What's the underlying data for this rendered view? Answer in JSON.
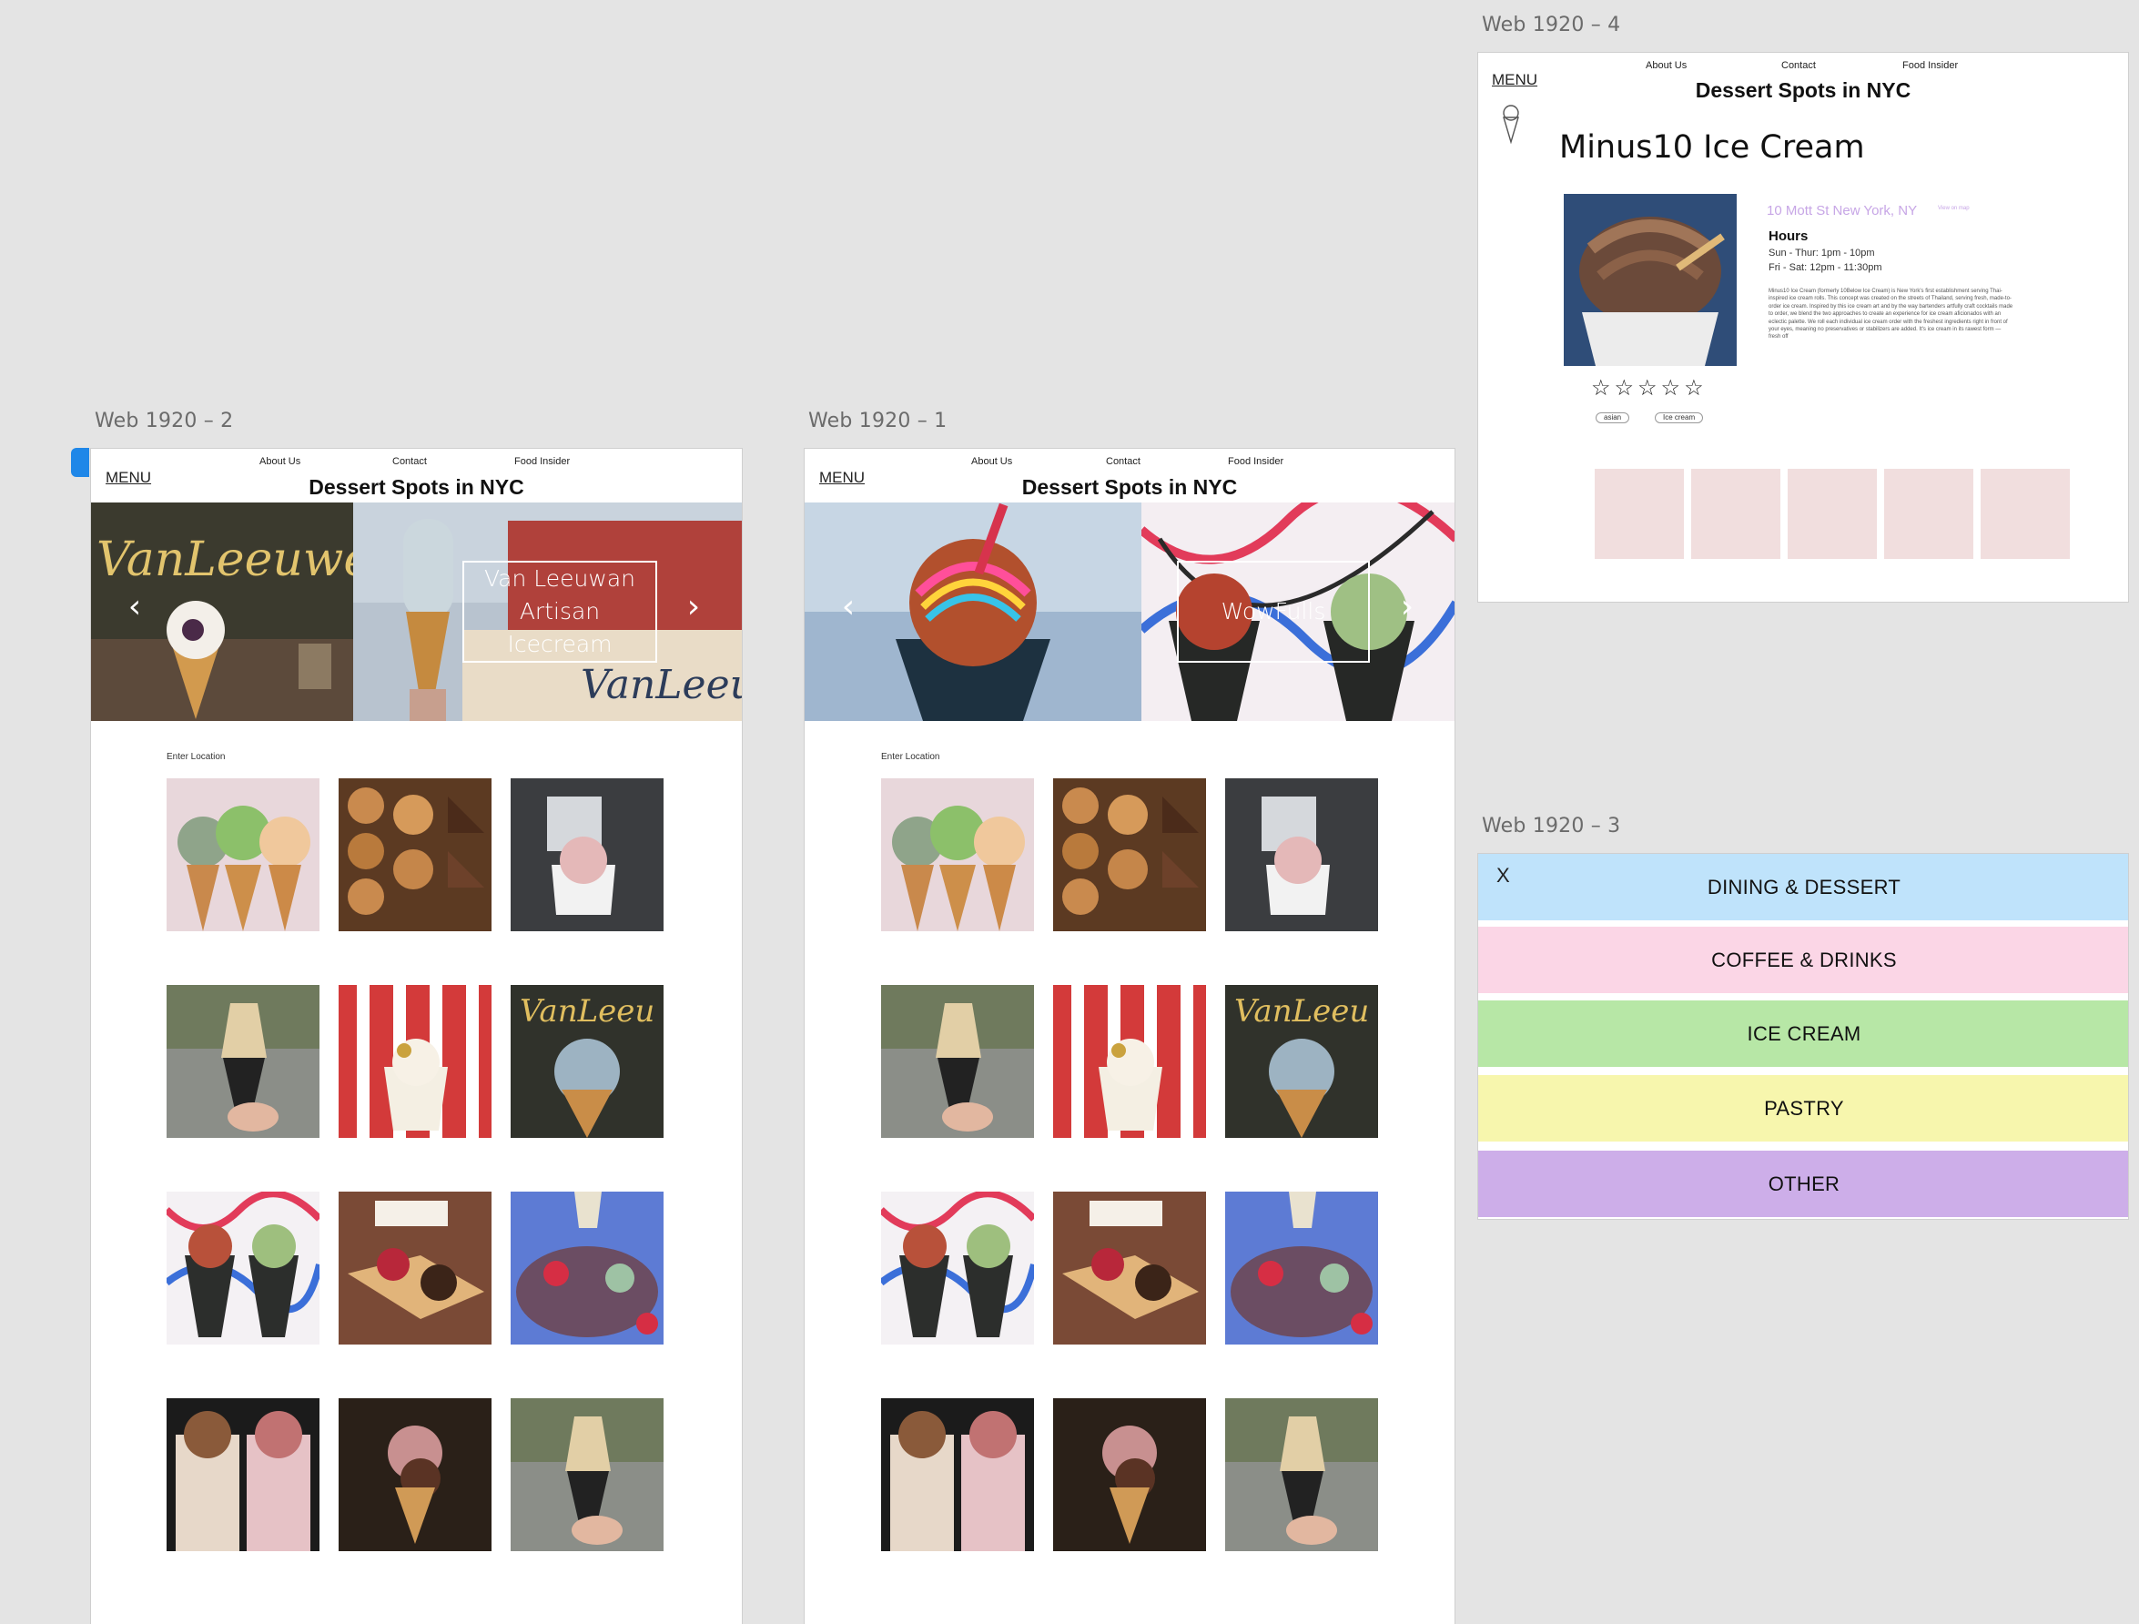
{
  "artboards": {
    "web2": {
      "label": "Web 1920 – 2",
      "hero_caption": "Van Leeuwan Artisan Icecream"
    },
    "web1": {
      "label": "Web 1920 – 1",
      "hero_caption": "WowFulls"
    },
    "web4": {
      "label": "Web 1920 – 4"
    },
    "web3": {
      "label": "Web 1920 – 3"
    }
  },
  "site": {
    "title": "Dessert Spots in NYC",
    "menu_label": "MENU",
    "nav": [
      "About Us",
      "Contact",
      "Food Insider"
    ],
    "enter_location": "Enter Location",
    "arrow_prev": "‹",
    "arrow_next": "›"
  },
  "detail": {
    "name": "Minus10 Ice Cream",
    "address": "10 Mott St New York, NY",
    "map_link": "View on map",
    "hours_heading": "Hours",
    "hours": [
      "Sun - Thur: 1pm - 10pm",
      "Fri - Sat: 12pm - 11:30pm"
    ],
    "description": "Minus10 Ice Cream (formerly 10Below Ice Cream) is New York's first establishment serving Thai-inspired ice cream rolls. This concept was created on the streets of Thailand, serving fresh, made-to-order ice cream. Inspired by this ice cream art and by the way bartenders artfully craft cocktails made to order, we blend the two approaches to create an experience for ice cream aficionados with an eclectic palette. We roll each individual ice cream order with the freshest ingredients right in front of your eyes, meaning no preservatives or stabilizers are added. It's ice cream in its rawest form — fresh off",
    "rating_stars": "☆☆☆☆☆",
    "tags": [
      "asian",
      "Ice cream"
    ]
  },
  "menu": {
    "close": "X",
    "items": [
      {
        "label": "DINING & DESSERT",
        "color": "#bfe3fb"
      },
      {
        "label": "COFFEE & DRINKS",
        "color": "#fbd6e6"
      },
      {
        "label": "ICE CREAM",
        "color": "#b7e7a6"
      },
      {
        "label": "PASTRY",
        "color": "#f7f6ad"
      },
      {
        "label": "OTHER",
        "color": "#cdaee9"
      }
    ]
  },
  "accent": {
    "address_color": "#c7a6e6",
    "placeholder_pink": "#f1dede",
    "selection_blue": "#1f87e8"
  }
}
